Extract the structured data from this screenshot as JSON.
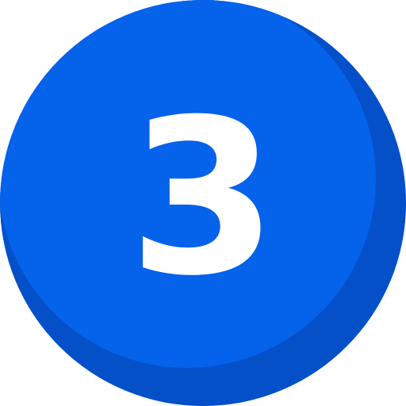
{
  "badge": {
    "number": "3",
    "icon": "number-3-circle-icon",
    "colors": {
      "base": "#0562EA",
      "shade": "#0450C9",
      "text": "#FFFFFF"
    }
  }
}
